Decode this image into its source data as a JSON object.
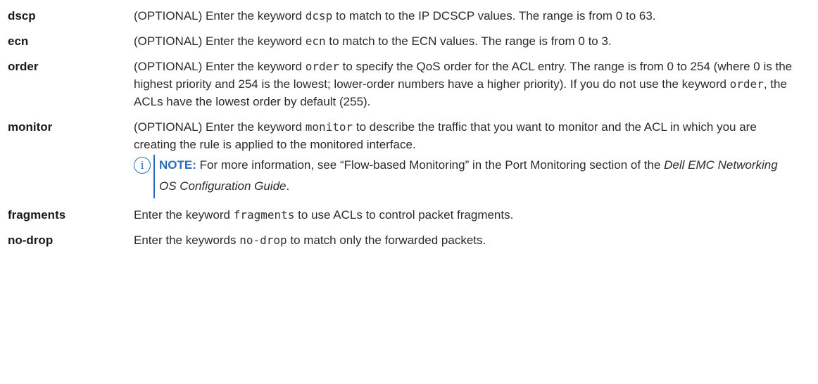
{
  "rows": [
    {
      "term": "dscp",
      "pre": "(OPTIONAL) Enter the keyword ",
      "code": "dcsp",
      "post": " to match to the IP DCSCP values. The range is from 0 to 63."
    },
    {
      "term": "ecn",
      "pre": "(OPTIONAL) Enter the keyword ",
      "code": "ecn",
      "post": " to match to the ECN values. The range is from 0 to 3."
    },
    {
      "term": "order",
      "pre": "(OPTIONAL) Enter the keyword ",
      "code": "order",
      "post": " to specify the QoS order for the ACL entry. The range is from 0 to 254 (where 0 is the highest priority and 254 is the lowest; lower-order numbers have a higher priority). If you do not use the keyword ",
      "code2": "order",
      "post2": ", the ACLs have the lowest order by default (255)."
    },
    {
      "term": "monitor",
      "pre": "(OPTIONAL) Enter the keyword ",
      "code": "monitor",
      "post": " to describe the traffic that you want to monitor and the ACL in which you are creating the rule is applied to the monitored interface.",
      "note": {
        "icon": "i",
        "label": "NOTE:",
        "text1": " For more information, see “Flow-based Monitoring” in the Port Monitoring section of the ",
        "italic": "Dell EMC Networking OS Configuration Guide",
        "text2": "."
      }
    },
    {
      "term": "fragments",
      "pre": "Enter the keyword ",
      "code": "fragments",
      "post": " to use ACLs to control packet fragments."
    },
    {
      "term": "no-drop",
      "pre": "Enter the keywords ",
      "code": "no-drop",
      "post": " to match only the forwarded packets."
    }
  ]
}
